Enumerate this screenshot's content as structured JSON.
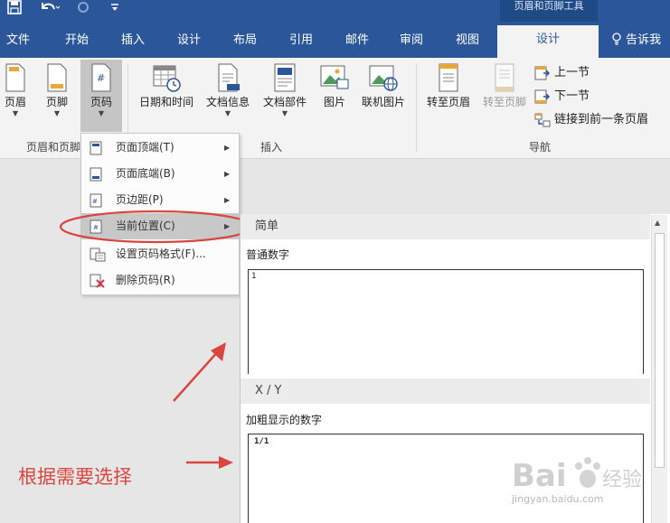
{
  "title_bar": {
    "contextual_tab_title": "页眉和页脚工具",
    "save_icon": "save-icon",
    "undo_icon": "undo-icon",
    "redo_icon": "redo-icon",
    "customize_icon": "customize-toolbar-icon"
  },
  "tabs": [
    {
      "label": "文件"
    },
    {
      "label": "开始"
    },
    {
      "label": "插入"
    },
    {
      "label": "设计"
    },
    {
      "label": "布局"
    },
    {
      "label": "引用"
    },
    {
      "label": "邮件"
    },
    {
      "label": "审阅"
    },
    {
      "label": "视图"
    },
    {
      "label": "设计",
      "active": true
    }
  ],
  "tell_me": "告诉我",
  "ribbon": {
    "header_footer_group": {
      "label": "页眉和页脚",
      "header": "页眉",
      "footer": "页脚",
      "page_number": "页码"
    },
    "insert_group": {
      "label": "插入",
      "date_time": "日期和时间",
      "doc_info": "文档信息",
      "doc_parts": "文档部件",
      "picture": "图片",
      "online_picture": "联机图片"
    },
    "nav_group": {
      "label": "导航",
      "goto_header": "转至页眉",
      "goto_footer": "转至页脚",
      "previous": "上一节",
      "next": "下一节",
      "link_previous": "链接到前一条页眉"
    }
  },
  "page_number_menu": {
    "items": [
      {
        "label": "页面顶端(T)",
        "submenu": true
      },
      {
        "label": "页面底端(B)",
        "submenu": true
      },
      {
        "label": "页边距(P)",
        "submenu": true
      },
      {
        "label": "当前位置(C)",
        "submenu": true,
        "highlighted": true
      },
      {
        "label": "设置页码格式(F)...",
        "submenu": false
      },
      {
        "label": "删除页码(R)",
        "submenu": false
      }
    ]
  },
  "gallery": {
    "section1": {
      "header": "简单",
      "item_label": "普通数字",
      "preview": "1"
    },
    "section2": {
      "header": "X / Y",
      "item_label": "加粗显示的数字",
      "preview": "1/1"
    }
  },
  "annotation": {
    "text": "根据需要选择",
    "color": "#d9463f"
  },
  "watermark": {
    "logo": "Bai度经验",
    "url": "jingyan.baidu.com"
  },
  "colors": {
    "ribbon_blue": "#2b579a",
    "ribbon_bg": "#f3f3f3",
    "menu_highlight": "#c8c8c8",
    "annotation_red": "#d9463f"
  }
}
